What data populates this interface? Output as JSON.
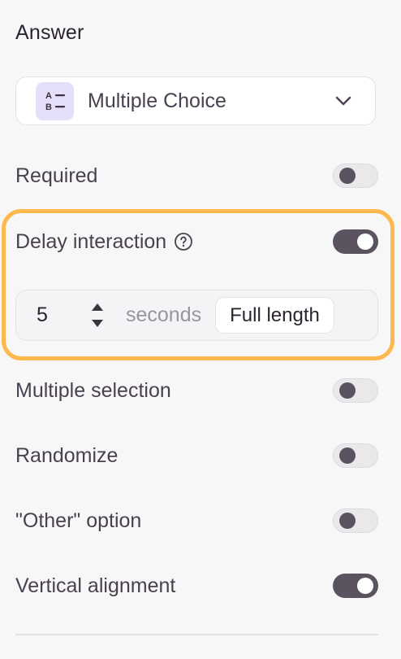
{
  "section": {
    "title": "Answer"
  },
  "answer_type": {
    "label": "Multiple Choice",
    "icon": "ab-list-icon",
    "icon_bg": "#e6dffa",
    "icon_color": "#3a3340"
  },
  "settings": {
    "required": {
      "label": "Required",
      "enabled": false
    },
    "delay_interaction": {
      "label": "Delay interaction",
      "enabled": true,
      "value": "5",
      "unit": "seconds",
      "full_length_label": "Full length"
    },
    "multiple_selection": {
      "label": "Multiple selection",
      "enabled": false
    },
    "randomize": {
      "label": "Randomize",
      "enabled": false
    },
    "other_option": {
      "label": "\"Other\" option",
      "enabled": false
    },
    "vertical_alignment": {
      "label": "Vertical alignment",
      "enabled": true
    }
  },
  "colors": {
    "highlight": "#ffb84d",
    "toggle_on": "#5c5360",
    "toggle_off": "#eae8eb"
  }
}
